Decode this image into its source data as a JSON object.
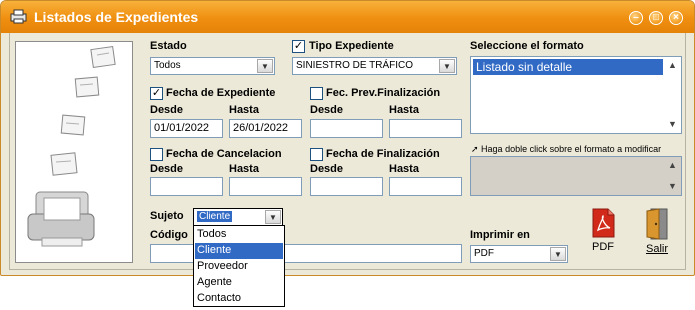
{
  "window": {
    "title": "Listados de Expedientes"
  },
  "form": {
    "estado": {
      "label": "Estado",
      "value": "Todos"
    },
    "tipo_expediente": {
      "label": "Tipo Expediente",
      "value": "SINIESTRO DE TRÁFICO",
      "checked": true
    },
    "fecha_expediente": {
      "label": "Fecha de Expediente",
      "checked": true,
      "desde_label": "Desde",
      "hasta_label": "Hasta",
      "desde": "01/01/2022",
      "hasta": "26/01/2022"
    },
    "fec_prev_finalizacion": {
      "label": "Fec. Prev.Finalización",
      "checked": false,
      "desde_label": "Desde",
      "hasta_label": "Hasta",
      "desde": "",
      "hasta": ""
    },
    "fecha_cancelacion": {
      "label": "Fecha de Cancelacion",
      "checked": false,
      "desde_label": "Desde",
      "hasta_label": "Hasta",
      "desde": "",
      "hasta": ""
    },
    "fecha_finalizacion": {
      "label": "Fecha de Finalización",
      "checked": false,
      "desde_label": "Desde",
      "hasta_label": "Hasta",
      "desde": "",
      "hasta": ""
    },
    "sujeto": {
      "label": "Sujeto",
      "value": "Cliente",
      "options": [
        "Todos",
        "Cliente",
        "Proveedor",
        "Agente",
        "Contacto"
      ],
      "highlighted": "Cliente"
    },
    "codigo": {
      "label": "Código",
      "value": ""
    }
  },
  "formato": {
    "label": "Seleccione el formato",
    "selected": "Listado sin detalle",
    "hint": "Haga doble click sobre el formato a modificar"
  },
  "imprimir": {
    "label": "Imprimir en",
    "value": "PDF"
  },
  "buttons": {
    "pdf": "PDF",
    "salir": "Salir"
  },
  "colors": {
    "titlebar": "#f29a1a",
    "selection": "#316ac5",
    "window_bg": "#ece9d8"
  }
}
